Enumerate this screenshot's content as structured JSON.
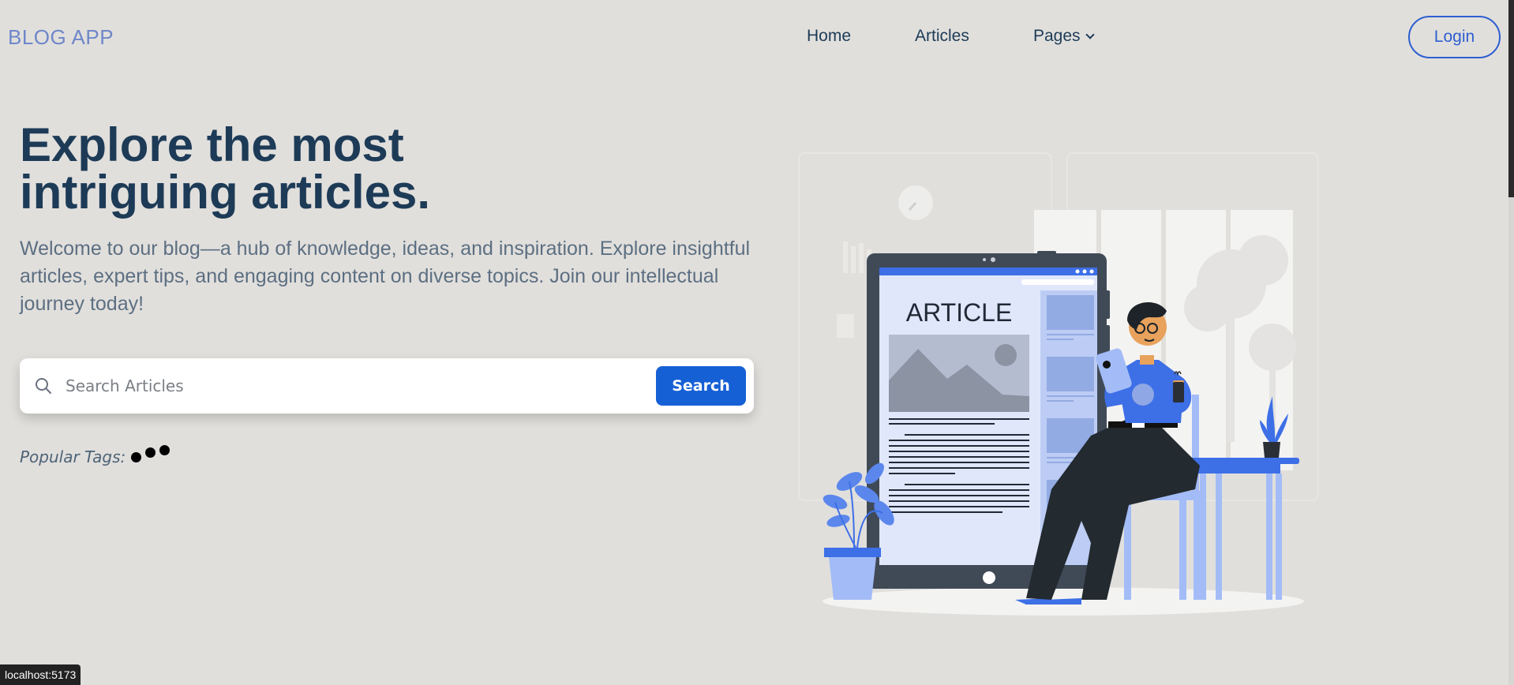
{
  "nav": {
    "brand": "BLOG APP",
    "links": [
      "Home",
      "Articles",
      "Pages"
    ],
    "login_label": "Login"
  },
  "hero": {
    "title_line1": "Explore the most",
    "title_line2": "intriguing articles.",
    "description": "Welcome to our blog—a hub of knowledge, ideas, and inspiration. Explore insightful articles, expert tips, and engaging content on diverse topics. Join our intellectual journey today!"
  },
  "search": {
    "placeholder": "Search Articles",
    "value": "",
    "button_label": "Search"
  },
  "tags": {
    "label": "Popular Tags:"
  },
  "illustration": {
    "headline": "ARTICLE"
  },
  "status_bar": {
    "url": "localhost:5173"
  },
  "colors": {
    "background": "#e1dfdc",
    "brand": "#6e87c9",
    "heading": "#1d3b57",
    "primary": "#1660d6",
    "accent_blue": "#3d6fe6"
  }
}
